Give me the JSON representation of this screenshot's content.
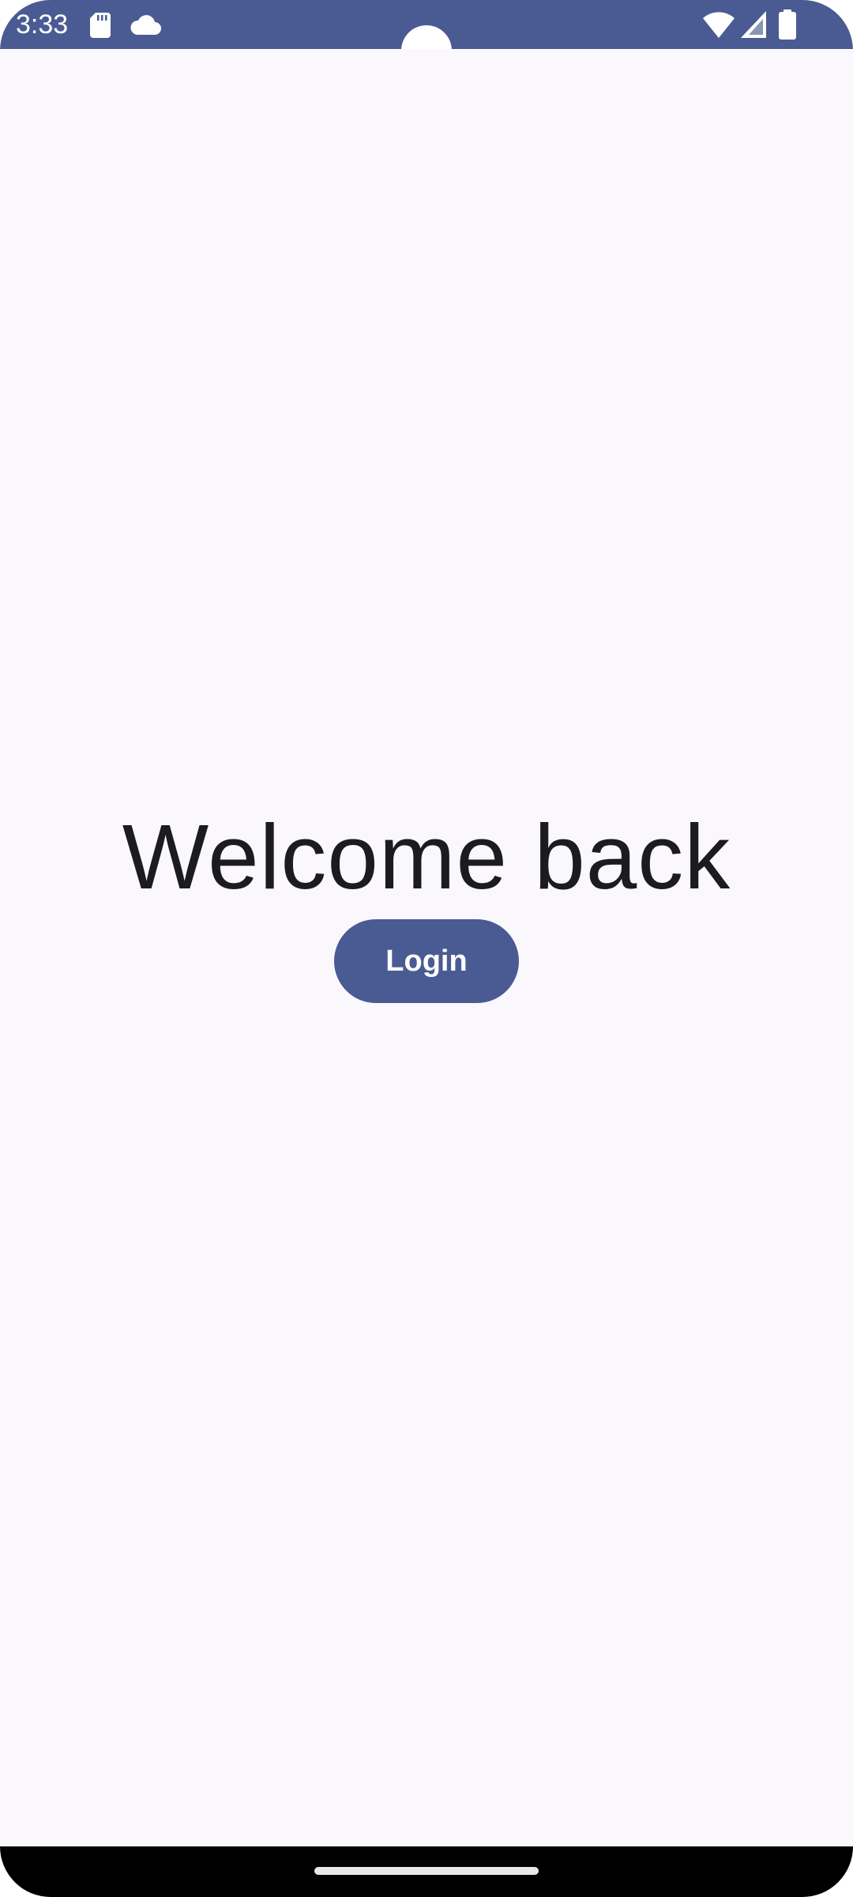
{
  "status_bar": {
    "time": "3:33",
    "background_color": "#4a5b93",
    "icons": [
      "sd-card-icon",
      "cloud-icon",
      "wifi-icon",
      "cellular-signal-icon",
      "battery-icon"
    ]
  },
  "main": {
    "title": "Welcome back",
    "login_button_label": "Login",
    "accent_color": "#4a5b93",
    "background_color": "#faf8fc"
  },
  "navigation_bar": {
    "type": "gesture",
    "indicator_icon": "home-indicator"
  }
}
